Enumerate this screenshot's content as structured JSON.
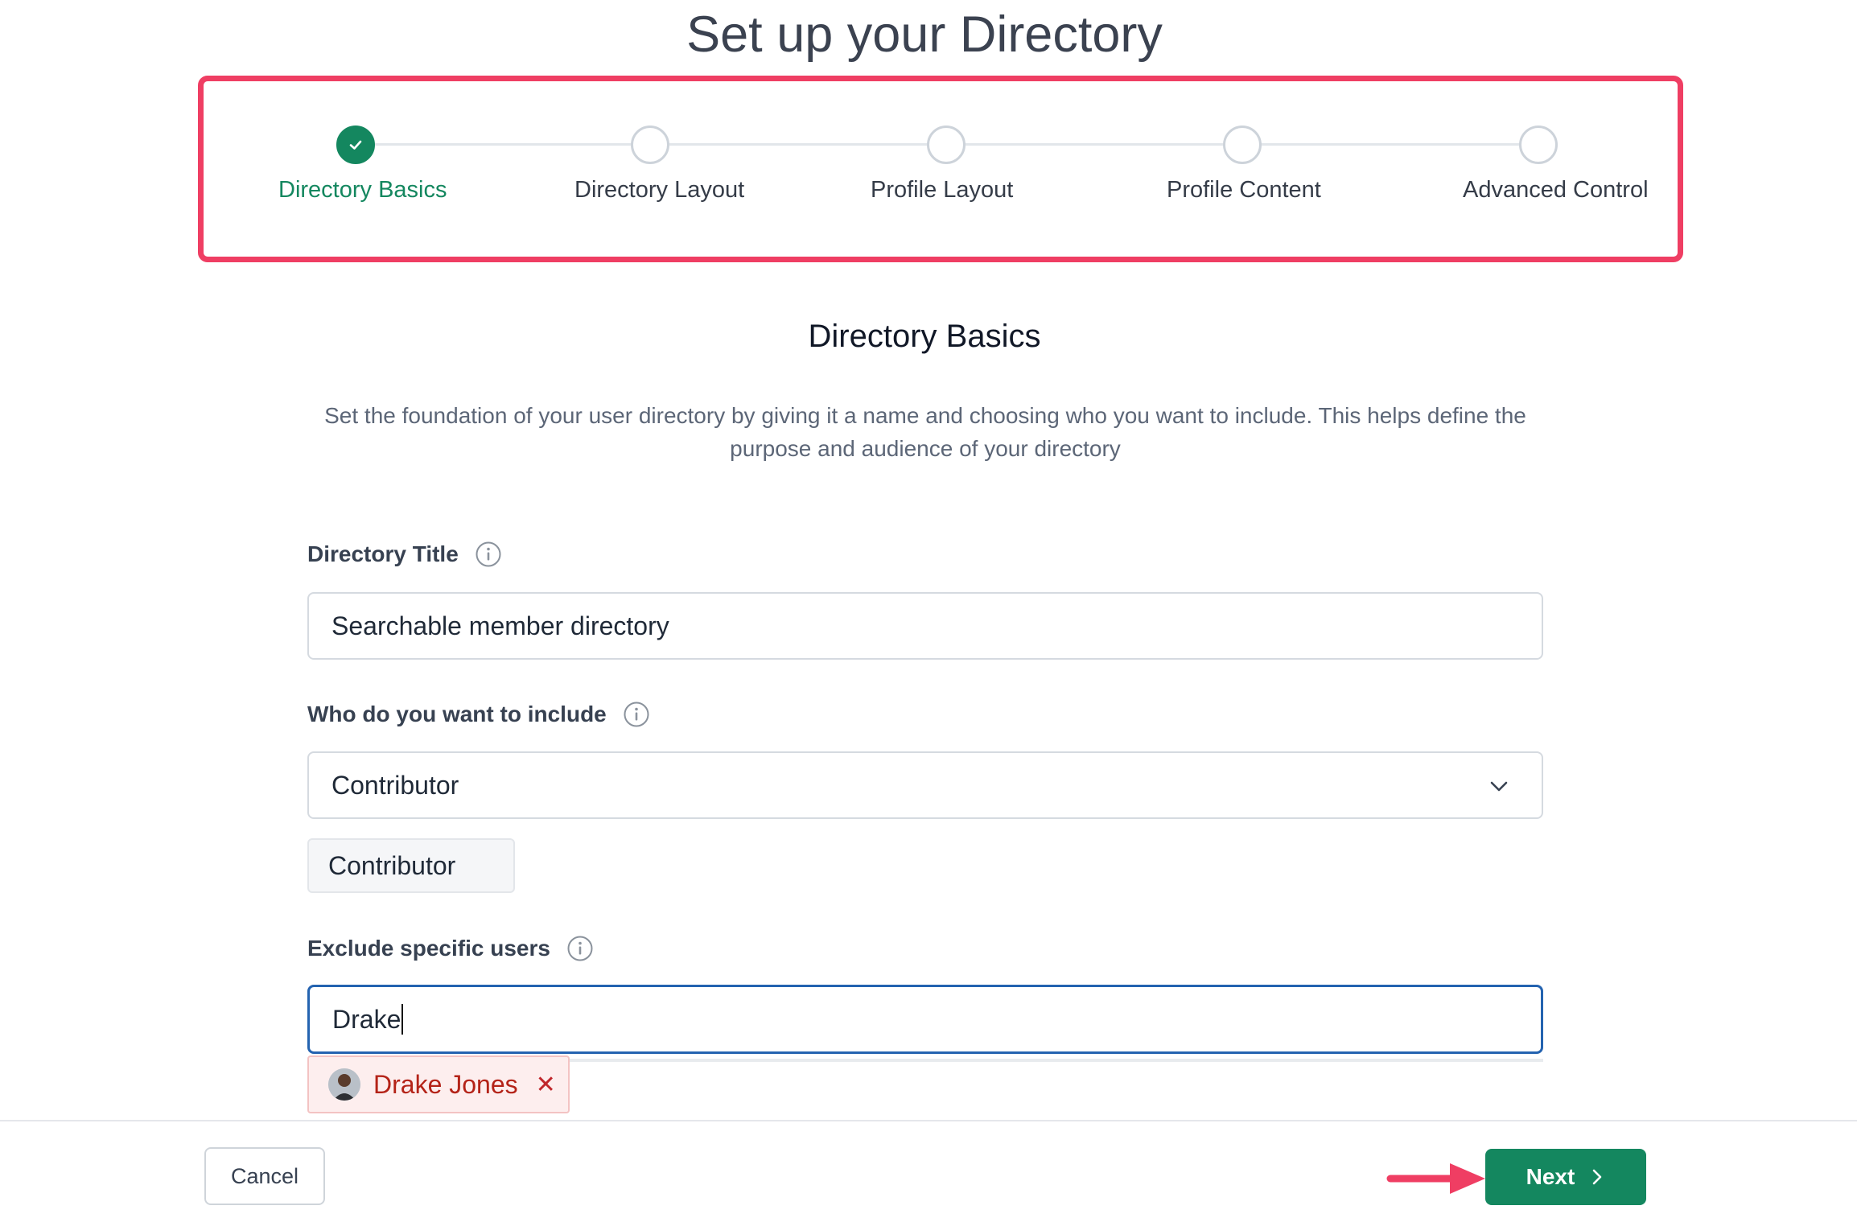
{
  "header": {
    "title": "Set up your Directory"
  },
  "stepper": {
    "steps": [
      {
        "label": "Directory Basics",
        "state": "completed"
      },
      {
        "label": "Directory Layout",
        "state": "pending"
      },
      {
        "label": "Profile Layout",
        "state": "pending"
      },
      {
        "label": "Profile Content",
        "state": "pending"
      },
      {
        "label": "Advanced Control",
        "state": "pending"
      }
    ],
    "highlight_color": "#ef3e63"
  },
  "section": {
    "title": "Directory Basics",
    "description": "Set the foundation of your user directory by giving it a name and choosing who you want to include. This helps define the purpose and audience of your directory"
  },
  "form": {
    "title_field": {
      "label": "Directory Title",
      "value": "Searchable member directory",
      "icon": "info-icon"
    },
    "include_field": {
      "label": "Who do you want to include",
      "selected": "Contributor",
      "tags": [
        "Contributor"
      ],
      "icon": "info-icon"
    },
    "exclude_field": {
      "label": "Exclude specific users",
      "value": "Drake",
      "icon": "info-icon",
      "selected_users": [
        {
          "name": "Drake Jones",
          "remove_icon": "close-icon"
        }
      ]
    }
  },
  "footer": {
    "cancel_label": "Cancel",
    "next_label": "Next"
  },
  "colors": {
    "accent": "#14875f",
    "annotation": "#ef3e63",
    "focus": "#2463b0"
  }
}
